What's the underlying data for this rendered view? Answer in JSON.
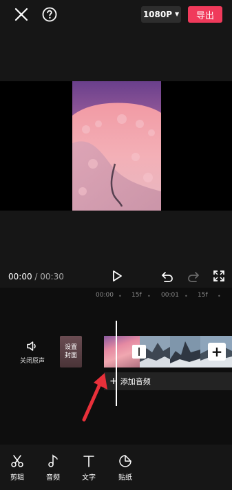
{
  "header": {
    "resolution_label": "1080P",
    "export_label": "导出"
  },
  "playback": {
    "current_time": "00:00",
    "separator": " / ",
    "total_time": "00:30"
  },
  "timeline": {
    "ruler_labels": [
      "00:00",
      "15f",
      "00:01",
      "15f"
    ],
    "mute_label": "关闭原声",
    "cover_line1": "设置",
    "cover_line2": "封面",
    "add_clip_symbol": "+",
    "add_audio_plus": "+",
    "add_audio_label": "添加音频"
  },
  "toolbar": {
    "items": [
      {
        "label": "剪辑",
        "icon": "scissors-icon"
      },
      {
        "label": "音频",
        "icon": "music-note-icon"
      },
      {
        "label": "文字",
        "icon": "text-icon"
      },
      {
        "label": "贴纸",
        "icon": "sticker-icon"
      }
    ]
  },
  "colors": {
    "accent": "#f03a5b",
    "annotation": "#e8303a"
  }
}
